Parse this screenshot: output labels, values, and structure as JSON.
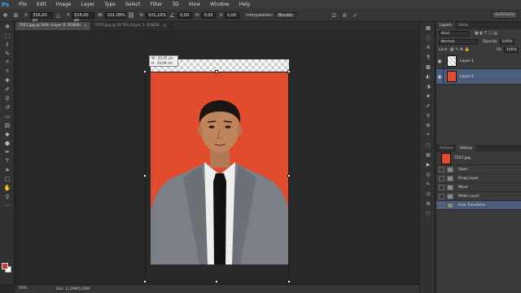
{
  "app": {
    "logo": "Ps"
  },
  "menu": [
    "File",
    "Edit",
    "Image",
    "Layer",
    "Type",
    "Select",
    "Filter",
    "3D",
    "View",
    "Window",
    "Help"
  ],
  "options": {
    "x_label": "X:",
    "x_value": "356,00 px",
    "y_label": "Y:",
    "y_value": "626,00 px",
    "w_label": "W:",
    "w_value": "101,08%",
    "h_label": "H:",
    "h_value": "101,10%",
    "angle_value": "0,00",
    "hskew_label": "H:",
    "hskew_value": "0,00",
    "vskew_label": "V:",
    "vskew_value": "0,00",
    "interp_label": "Interpolation:",
    "interp_value": "Bicubic",
    "workspace": "SUPERATD"
  },
  "tabs": [
    {
      "label": "7051.jpg @ 50% (Layer 0, RGB/8)",
      "active": true
    },
    {
      "label": "7070.jpg @ 40,5% (Layer 1, RGB/8)",
      "active": false
    }
  ],
  "canvas": {
    "tooltip_w": "W : 25,05 cm",
    "tooltip_h": "H : 26,09 cm"
  },
  "status": {
    "zoom": "50%",
    "doc": "Doc: 2,10M/5,04M"
  },
  "layers_panel": {
    "tabs": [
      "Layers",
      "Paths"
    ],
    "kind": "Kind",
    "blend_mode": "Normal",
    "opacity_label": "Opacity:",
    "opacity_value": "100%",
    "lock_label": "Lock:",
    "fill_label": "Fill:",
    "fill_value": "100%",
    "layers": [
      {
        "name": "Layer 1",
        "selected": false
      },
      {
        "name": "Layer 0",
        "selected": true
      }
    ]
  },
  "history_panel": {
    "tabs": [
      "Actions",
      "History"
    ],
    "snapshot": "7051.jpg",
    "items": [
      {
        "name": "Open",
        "selected": false
      },
      {
        "name": "Drag Layer",
        "selected": false
      },
      {
        "name": "Move",
        "selected": false
      },
      {
        "name": "Make Layer",
        "selected": false
      },
      {
        "name": "Free Transform",
        "selected": true
      }
    ]
  },
  "colors": {
    "foreground": "#c8382a",
    "background": "#ffffff",
    "photo_bg": "#e14c2c",
    "selection": "#4a5e7c"
  }
}
